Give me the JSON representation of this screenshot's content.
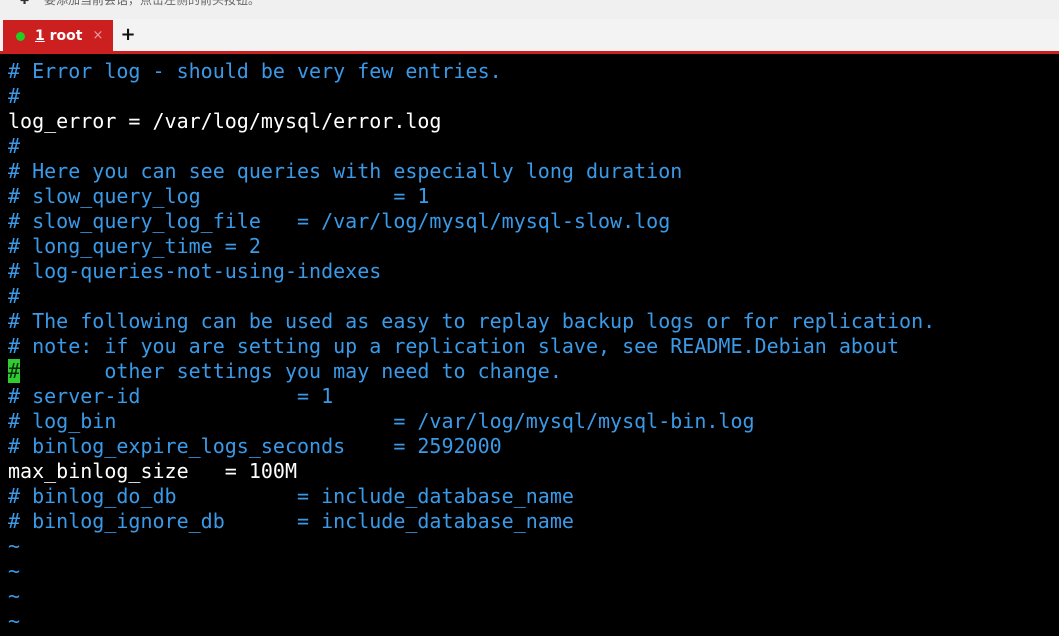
{
  "hint_bar": {
    "text": "要添加当前会话，点击左侧的箭头按钮。",
    "icon": "pin-icon"
  },
  "tabs": [
    {
      "number": "1",
      "label": "root",
      "status_color": "#22cc22",
      "active": true
    }
  ],
  "tab_close": "×",
  "tab_add": "+",
  "colors": {
    "accent": "#cc1f1f",
    "comment": "#3a9ae8",
    "plain": "#ffffff",
    "cursor": "#2ecc2e"
  },
  "terminal": {
    "lines": [
      {
        "text": "# Error log - should be very few entries.",
        "kind": "comment"
      },
      {
        "text": "#",
        "kind": "comment"
      },
      {
        "text": "log_error = /var/log/mysql/error.log",
        "kind": "plain"
      },
      {
        "text": "#",
        "kind": "comment"
      },
      {
        "text": "# Here you can see queries with especially long duration",
        "kind": "comment"
      },
      {
        "text": "# slow_query_log                = 1",
        "kind": "comment"
      },
      {
        "text": "# slow_query_log_file   = /var/log/mysql/mysql-slow.log",
        "kind": "comment"
      },
      {
        "text": "# long_query_time = 2",
        "kind": "comment"
      },
      {
        "text": "# log-queries-not-using-indexes",
        "kind": "comment"
      },
      {
        "text": "#",
        "kind": "comment"
      },
      {
        "text": "# The following can be used as easy to replay backup logs or for replication.",
        "kind": "comment"
      },
      {
        "text": "# note: if you are setting up a replication slave, see README.Debian about",
        "kind": "comment"
      },
      {
        "text": "#       other settings you may need to change.",
        "kind": "cursor-comment"
      },
      {
        "text": "# server-id             = 1",
        "kind": "comment"
      },
      {
        "text": "# log_bin                       = /var/log/mysql/mysql-bin.log",
        "kind": "comment"
      },
      {
        "text": "# binlog_expire_logs_seconds    = 2592000",
        "kind": "comment"
      },
      {
        "text": "max_binlog_size   = 100M",
        "kind": "plain"
      },
      {
        "text": "# binlog_do_db          = include_database_name",
        "kind": "comment"
      },
      {
        "text": "# binlog_ignore_db      = include_database_name",
        "kind": "comment"
      },
      {
        "text": "~",
        "kind": "tilde"
      },
      {
        "text": "~",
        "kind": "tilde"
      },
      {
        "text": "~",
        "kind": "tilde"
      },
      {
        "text": "~",
        "kind": "tilde"
      }
    ]
  }
}
